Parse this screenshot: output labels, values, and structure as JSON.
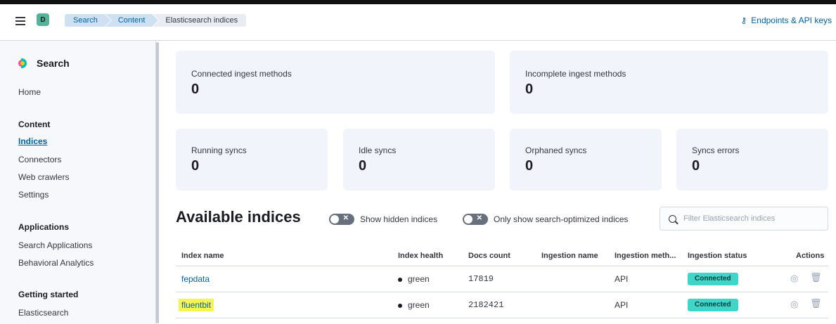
{
  "header": {
    "logo_letter": "D",
    "breadcrumbs": [
      "Search",
      "Content",
      "Elasticsearch indices"
    ],
    "endpoints_label": "Endpoints & API keys",
    "endpoints_icon": "key-icon"
  },
  "sidebar": {
    "title": "Search",
    "home": "Home",
    "content_heading": "Content",
    "content_items": [
      "Indices",
      "Connectors",
      "Web crawlers",
      "Settings"
    ],
    "applications_heading": "Applications",
    "applications_items": [
      "Search Applications",
      "Behavioral Analytics"
    ],
    "getting_started_heading": "Getting started",
    "getting_started_items": [
      "Elasticsearch"
    ]
  },
  "stats": {
    "connected_label": "Connected ingest methods",
    "connected_value": "0",
    "incomplete_label": "Incomplete ingest methods",
    "incomplete_value": "0",
    "running_label": "Running syncs",
    "running_value": "0",
    "idle_label": "Idle syncs",
    "idle_value": "0",
    "orphaned_label": "Orphaned syncs",
    "orphaned_value": "0",
    "errors_label": "Syncs errors",
    "errors_value": "0"
  },
  "indices": {
    "title": "Available indices",
    "toggle_hidden": "Show hidden indices",
    "toggle_optimized": "Only show search-optimized indices",
    "search_placeholder": "Filter Elasticsearch indices",
    "columns": [
      "Index name",
      "Index health",
      "Docs count",
      "Ingestion name",
      "Ingestion meth...",
      "Ingestion status",
      "Actions"
    ],
    "rows": [
      {
        "name": "fepdata",
        "health": "green",
        "docs": "17819",
        "ingestion_name": "",
        "method": "API",
        "status": "Connected"
      },
      {
        "name": "fluentbit",
        "health": "green",
        "docs": "2182421",
        "ingestion_name": "",
        "method": "API",
        "status": "Connected"
      }
    ]
  },
  "colors": {
    "accent": "#0061a6",
    "status_connected": "#3fd5c8",
    "highlight": "#f7f552"
  }
}
